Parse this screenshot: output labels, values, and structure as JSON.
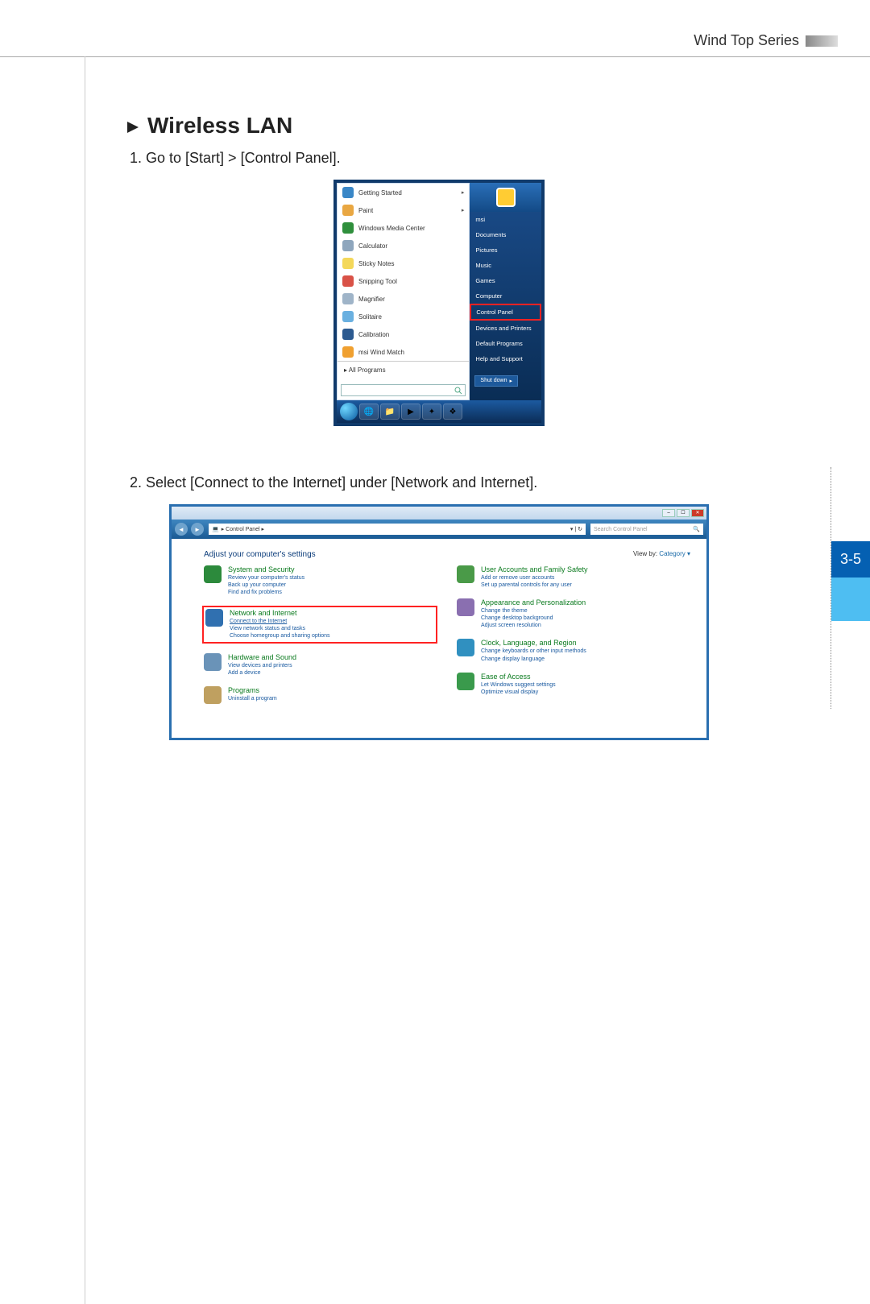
{
  "header": {
    "series": "Wind Top Series"
  },
  "page_tab": "3-5",
  "section": {
    "title": "Wireless LAN",
    "step1": "1.  Go to [Start] > [Control Panel].",
    "step2": "2.  Select [Connect to the Internet] under [Network and Internet]."
  },
  "start_menu": {
    "left_items": [
      {
        "label": "Getting Started",
        "icon_color": "#3a87c7",
        "submenu": true
      },
      {
        "label": "Paint",
        "icon_color": "#e9a742",
        "submenu": true
      },
      {
        "label": "Windows Media Center",
        "icon_color": "#2f8f3c",
        "submenu": false
      },
      {
        "label": "Calculator",
        "icon_color": "#8ea6bd",
        "submenu": false
      },
      {
        "label": "Sticky Notes",
        "icon_color": "#f4d85a",
        "submenu": false
      },
      {
        "label": "Snipping Tool",
        "icon_color": "#d95247",
        "submenu": false
      },
      {
        "label": "Magnifier",
        "icon_color": "#9fb4c8",
        "submenu": false
      },
      {
        "label": "Solitaire",
        "icon_color": "#6ab0e0",
        "submenu": false
      },
      {
        "label": "Calibration",
        "icon_color": "#2c5a90",
        "submenu": false
      },
      {
        "label": "msi Wind Match",
        "icon_color": "#f0a030",
        "submenu": false
      }
    ],
    "all_programs": "All Programs",
    "right_items": [
      "msi",
      "Documents",
      "Pictures",
      "Music",
      "Games",
      "Computer"
    ],
    "control_panel": "Control Panel",
    "right_items2": [
      "Devices and Printers",
      "Default Programs",
      "Help and Support"
    ],
    "shutdown": "Shut down"
  },
  "control_panel": {
    "breadcrumb": "▸ Control Panel ▸",
    "search_placeholder": "Search Control Panel",
    "adjust": "Adjust your computer's settings",
    "viewby_label": "View by:",
    "viewby_value": "Category ▾",
    "left": [
      {
        "title": "System and Security",
        "links": [
          "Review your computer's status",
          "Back up your computer",
          "Find and fix problems"
        ],
        "icon": "#2c8a3c",
        "highlight": false
      },
      {
        "title": "Network and Internet",
        "links": [
          "Connect to the Internet",
          "View network status and tasks",
          "Choose homegroup and sharing options"
        ],
        "icon": "#3070b0",
        "highlight": true
      },
      {
        "title": "Hardware and Sound",
        "links": [
          "View devices and printers",
          "Add a device"
        ],
        "icon": "#6a93b8",
        "highlight": false
      },
      {
        "title": "Programs",
        "links": [
          "Uninstall a program"
        ],
        "icon": "#bfa060",
        "highlight": false
      }
    ],
    "right": [
      {
        "title": "User Accounts and Family Safety",
        "links": [
          "Add or remove user accounts",
          "Set up parental controls for any user"
        ],
        "icon": "#4a9a48",
        "highlight": false
      },
      {
        "title": "Appearance and Personalization",
        "links": [
          "Change the theme",
          "Change desktop background",
          "Adjust screen resolution"
        ],
        "icon": "#8a6fb0",
        "highlight": false
      },
      {
        "title": "Clock, Language, and Region",
        "links": [
          "Change keyboards or other input methods",
          "Change display language"
        ],
        "icon": "#3090c0",
        "highlight": false
      },
      {
        "title": "Ease of Access",
        "links": [
          "Let Windows suggest settings",
          "Optimize visual display"
        ],
        "icon": "#3a9a4c",
        "highlight": false
      }
    ]
  }
}
